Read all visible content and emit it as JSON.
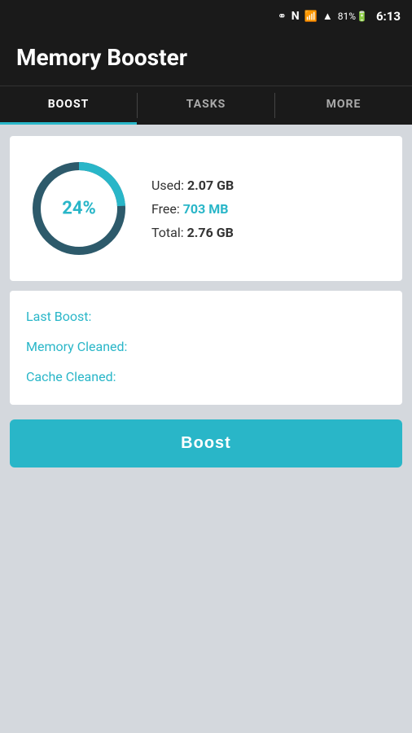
{
  "statusBar": {
    "battery": "81%",
    "time": "6:13"
  },
  "header": {
    "title": "Memory Booster"
  },
  "tabs": [
    {
      "id": "boost",
      "label": "BOOST",
      "active": true
    },
    {
      "id": "tasks",
      "label": "TASKS",
      "active": false
    },
    {
      "id": "more",
      "label": "MORE",
      "active": false
    }
  ],
  "memoryCard": {
    "percentage": "24%",
    "usedLabel": "Used: ",
    "usedValue": "2.07 GB",
    "freeLabel": "Free: ",
    "freeValue": "703 MB",
    "totalLabel": "Total: ",
    "totalValue": "2.76 GB",
    "percentNumeric": 24
  },
  "infoCard": {
    "lastBoost": "Last Boost:",
    "memoryCleaned": "Memory Cleaned:",
    "cacheCleaned": "Cache Cleaned:"
  },
  "boostButton": {
    "label": "Boost"
  },
  "colors": {
    "accent": "#29b6c8",
    "dark": "#2d5a6b"
  }
}
